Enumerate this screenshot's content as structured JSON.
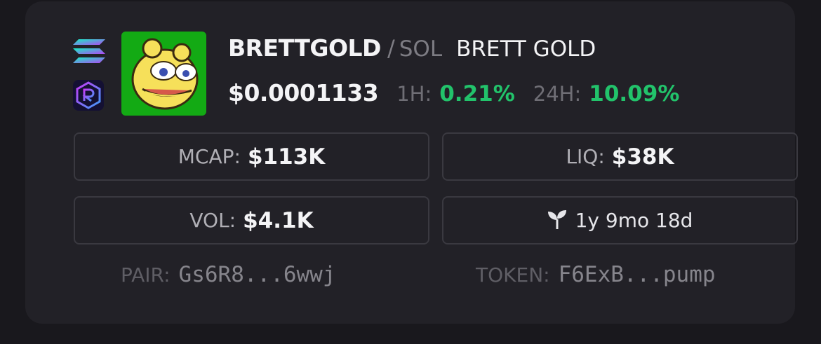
{
  "token": {
    "symbol": "BRETTGOLD",
    "separator": "/",
    "quote": "SOL",
    "name": "BRETT GOLD",
    "price": "$0.0001133",
    "change_1h_label": "1H:",
    "change_1h": "0.21%",
    "change_24h_label": "24H:",
    "change_24h": "10.09%"
  },
  "icons": {
    "chain": "solana-icon",
    "dex": "raydium-icon",
    "age": "seedling-icon",
    "avatar": "token-avatar"
  },
  "stats": {
    "mcap_label": "MCAP:",
    "mcap_value": "$113K",
    "liq_label": "LIQ:",
    "liq_value": "$38K",
    "vol_label": "VOL:",
    "vol_value": "$4.1K",
    "age": "1y 9mo 18d"
  },
  "addresses": {
    "pair_label": "PAIR:",
    "pair_value": "Gs6R8...6wwj",
    "token_label": "TOKEN:",
    "token_value": "F6ExB...pump"
  },
  "colors": {
    "background": "#19181d",
    "card": "#222127",
    "positive": "#22c36b",
    "avatar_bg": "#13aa14"
  }
}
